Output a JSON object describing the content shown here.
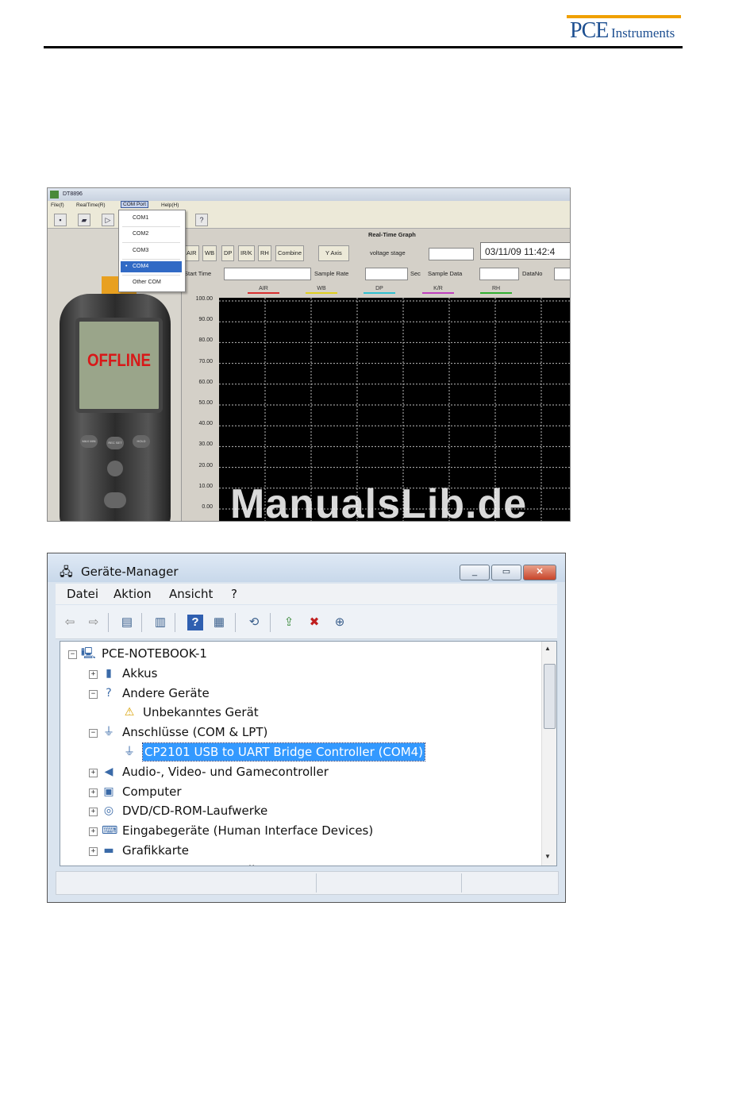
{
  "header": {
    "logo_pce": "PCE",
    "logo_instruments": "Instruments"
  },
  "app": {
    "title": "DT8896",
    "menu": [
      "File(f)",
      "RealTime(R)",
      "COM Port",
      "Help(H)"
    ],
    "com_menu": {
      "items": [
        "COM1",
        "COM2",
        "COM3",
        "COM4",
        "Other COM"
      ],
      "selected": "COM4"
    },
    "graph_title": "Real-Time Graph",
    "channel_checks": [
      "AIR",
      "WB",
      "DP",
      "IR/K",
      "RH",
      "Combine"
    ],
    "y_axis_button": "Y Axis",
    "voltage_label": "voltage stage",
    "datetime": "03/11/09 11:42:4",
    "start_time_label": "Start Time",
    "sample_rate_label": "Sample Rate",
    "sec_label": "Sec",
    "sample_data_label": "Sample Data",
    "datano_label": "DataNo",
    "device_display": "OFFLINE",
    "device_buttons": [
      "MAX MIN",
      "REC SET",
      "HOLD"
    ],
    "legend": [
      {
        "name": "AIR",
        "color": "#d83030"
      },
      {
        "name": "WB",
        "color": "#e0d020"
      },
      {
        "name": "DP",
        "color": "#30c0d0"
      },
      {
        "name": "K/R",
        "color": "#c040c0"
      },
      {
        "name": "RH",
        "color": "#30b030"
      }
    ],
    "y_ticks": [
      "100.00",
      "90.00",
      "80.00",
      "70.00",
      "60.00",
      "50.00",
      "40.00",
      "30.00",
      "20.00",
      "10.00",
      "0.00"
    ],
    "plot_background": "#000000"
  },
  "watermark": "ManualsLib.de",
  "device_manager": {
    "title": "Geräte-Manager",
    "menu": [
      "Datei",
      "Aktion",
      "Ansicht",
      "?"
    ],
    "tree": [
      {
        "label": "PCE-NOTEBOOK-1",
        "level": 0,
        "expander": "−",
        "icon": "computer-icon"
      },
      {
        "label": "Akkus",
        "level": 1,
        "expander": "+",
        "icon": "battery-icon"
      },
      {
        "label": "Andere Geräte",
        "level": 1,
        "expander": "−",
        "icon": "unknown-device-icon"
      },
      {
        "label": "Unbekanntes Gerät",
        "level": 2,
        "expander": "",
        "icon": "warning-icon"
      },
      {
        "label": "Anschlüsse (COM & LPT)",
        "level": 1,
        "expander": "−",
        "icon": "port-icon"
      },
      {
        "label": "CP2101 USB to UART Bridge Controller (COM4)",
        "level": 2,
        "expander": "",
        "icon": "port-icon",
        "selected": true
      },
      {
        "label": "Audio-, Video- und Gamecontroller",
        "level": 1,
        "expander": "+",
        "icon": "speaker-icon"
      },
      {
        "label": "Computer",
        "level": 1,
        "expander": "+",
        "icon": "monitor-icon"
      },
      {
        "label": "DVD/CD-ROM-Laufwerke",
        "level": 1,
        "expander": "+",
        "icon": "disc-icon"
      },
      {
        "label": "Eingabegeräte (Human Interface Devices)",
        "level": 1,
        "expander": "+",
        "icon": "keyboard-icon"
      },
      {
        "label": "Grafikkarte",
        "level": 1,
        "expander": "+",
        "icon": "display-adapter-icon"
      },
      {
        "label": "IDE ATA/ATAPI-Controller",
        "level": 1,
        "expander": "+",
        "icon": "controller-icon"
      }
    ],
    "selection_color": "#3399ff"
  }
}
